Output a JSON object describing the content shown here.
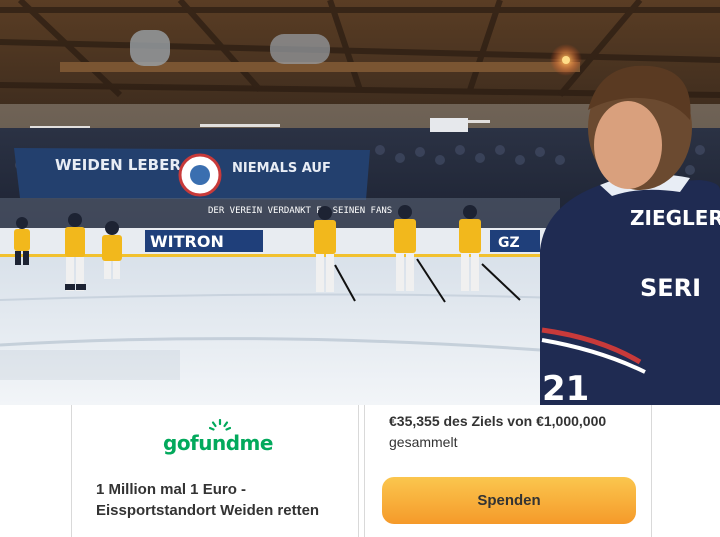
{
  "hero": {
    "banner_left_text": "WEIDEN LEBER",
    "banner_right_text": "NIEMALS AUF",
    "board_sponsor": "WITRON",
    "board_sponsor_small": "GZ",
    "fans_banner": "DER VEREIN VERDANKT ES SEINEN FANS",
    "player_name": "ZIEGLER",
    "player_name_2": "SERI",
    "player_number": "21"
  },
  "logo": {
    "text": "gofundme",
    "icon": "sun-icon",
    "color": "#02a95c"
  },
  "campaign": {
    "title": "1 Million mal 1 Euro - Eissportstandort Weiden retten"
  },
  "progress": {
    "amount_text": "€35,355 des Ziels von €1,000,000",
    "collected_label": "gesammelt",
    "raised": 35355,
    "goal": 1000000
  },
  "donate": {
    "label": "Spenden",
    "accent": "#f7a935"
  }
}
